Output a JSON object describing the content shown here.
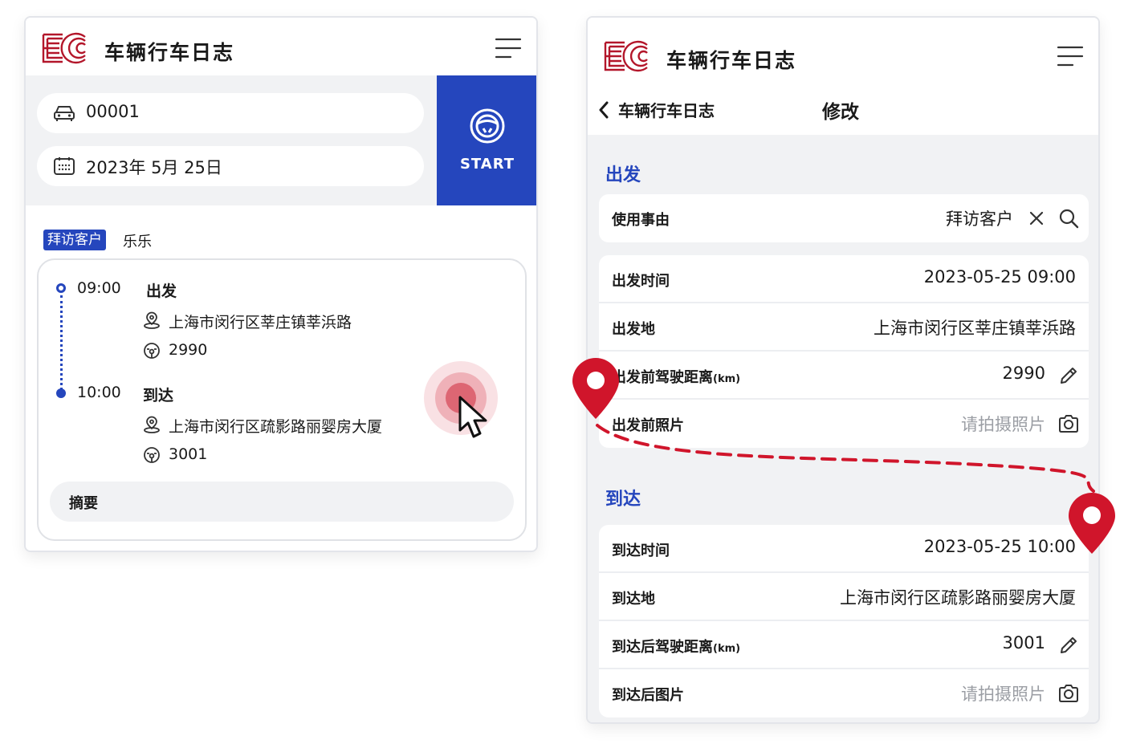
{
  "app": {
    "title": "车辆行车日志"
  },
  "left": {
    "plate": "00001",
    "date": "2023年 5月 25日",
    "start_label": "START",
    "tag": "拜访客户",
    "tag_name": "乐乐",
    "trip": {
      "depart": {
        "time": "09:00",
        "label": "出发",
        "address": "上海市闵行区莘庄镇莘浜路",
        "odometer": "2990"
      },
      "arrive": {
        "time": "10:00",
        "label": "到达",
        "address": "上海市闵行区疏影路丽婴房大厦",
        "odometer": "3001"
      }
    },
    "summary_label": "摘要"
  },
  "right": {
    "back_label": "车辆行车日志",
    "page_title": "修改",
    "purpose": {
      "label": "使用事由",
      "value": "拜访客户"
    },
    "depart_section": "出发",
    "depart_rows": {
      "time": {
        "label": "出发时间",
        "value": "2023-05-25 09:00"
      },
      "place": {
        "label": "出发地",
        "value": "上海市闵行区莘庄镇莘浜路"
      },
      "distance": {
        "label": "出发前驾驶距离",
        "unit": "(km)",
        "value": "2990"
      },
      "photo": {
        "label": "出发前照片",
        "placeholder": "请拍摄照片"
      }
    },
    "arrive_section": "到达",
    "arrive_rows": {
      "time": {
        "label": "到达时间",
        "value": "2023-05-25 10:00"
      },
      "place": {
        "label": "到达地",
        "value": "上海市闵行区疏影路丽婴房大厦"
      },
      "distance": {
        "label": "到达后驾驶距离",
        "unit": "(km)",
        "value": "3001"
      },
      "photo": {
        "label": "到达后图片",
        "placeholder": "请拍摄照片"
      }
    }
  },
  "colors": {
    "brand_red": "#b3162a",
    "accent_blue": "#2546bd",
    "pin_red": "#d0152b",
    "bg_gray": "#f1f2f4"
  },
  "icons": [
    "ec-logo",
    "hamburger-menu-icon",
    "car-icon",
    "calendar-icon",
    "steering-wheel-icon",
    "location-pin-icon",
    "odometer-icon",
    "chevron-left-icon",
    "close-icon",
    "search-icon",
    "pencil-icon",
    "camera-icon",
    "map-pin-icon",
    "cursor-icon"
  ]
}
